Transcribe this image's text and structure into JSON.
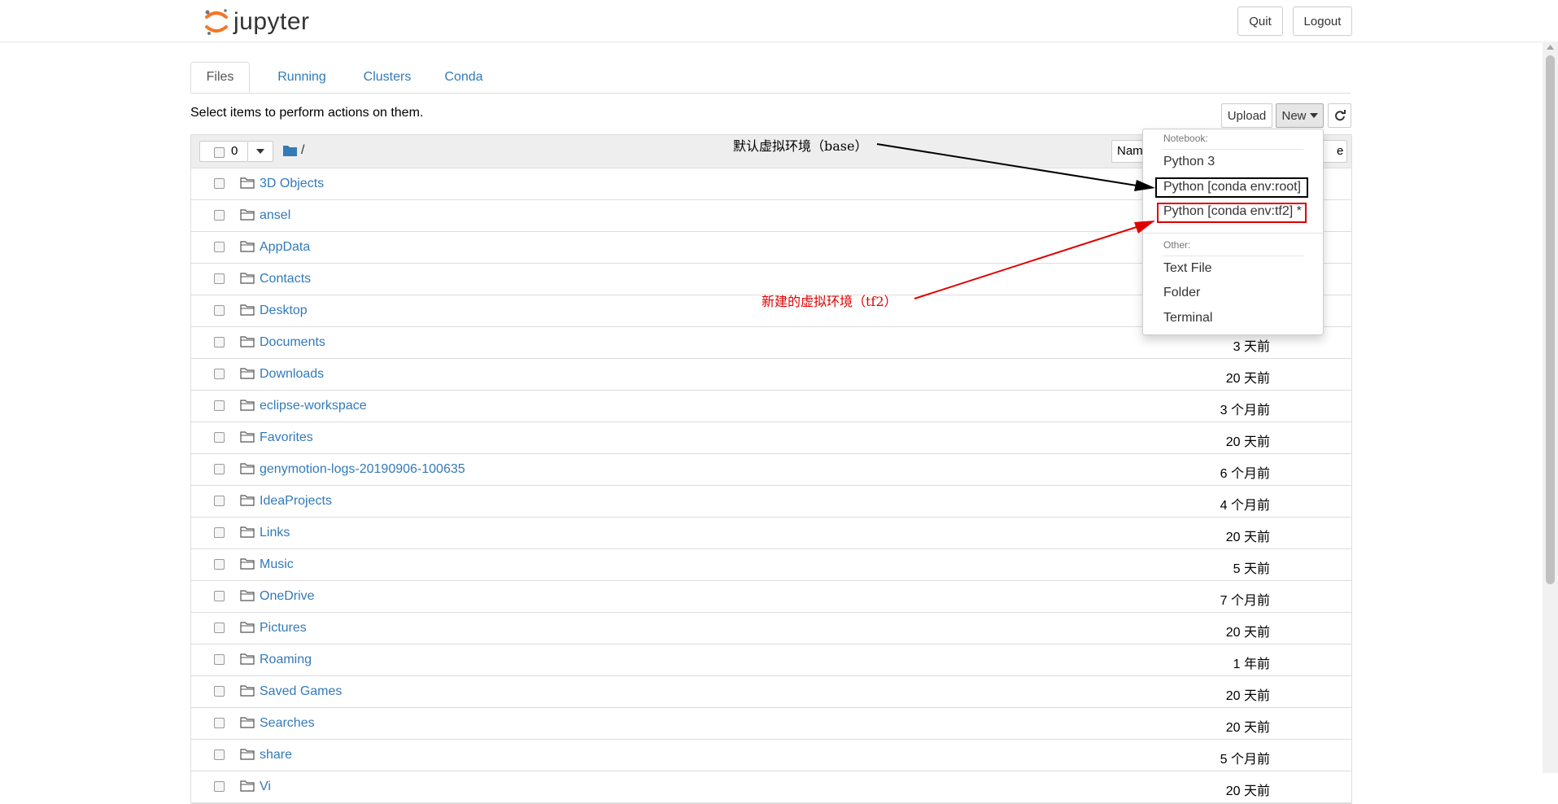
{
  "header": {
    "logo_text": "jupyter",
    "quit_label": "Quit",
    "logout_label": "Logout"
  },
  "tabs": [
    {
      "label": "Files",
      "active": true
    },
    {
      "label": "Running",
      "active": false
    },
    {
      "label": "Clusters",
      "active": false
    },
    {
      "label": "Conda",
      "active": false
    }
  ],
  "toolbar": {
    "hint": "Select items to perform actions on them.",
    "upload_label": "Upload",
    "new_label": "New",
    "refresh_icon": "refresh-icon",
    "selected_count": "0",
    "breadcrumb_path": "/",
    "name_sort_label": "Nam",
    "last_modified_label": "e"
  },
  "files": [
    {
      "name": "3D Objects",
      "modified": ""
    },
    {
      "name": "ansel",
      "modified": ""
    },
    {
      "name": "AppData",
      "modified": ""
    },
    {
      "name": "Contacts",
      "modified": ""
    },
    {
      "name": "Desktop",
      "modified": ""
    },
    {
      "name": "Documents",
      "modified": "3 天前"
    },
    {
      "name": "Downloads",
      "modified": "20 天前"
    },
    {
      "name": "eclipse-workspace",
      "modified": "3 个月前"
    },
    {
      "name": "Favorites",
      "modified": "20 天前"
    },
    {
      "name": "genymotion-logs-20190906-100635",
      "modified": "6 个月前"
    },
    {
      "name": "IdeaProjects",
      "modified": "4 个月前"
    },
    {
      "name": "Links",
      "modified": "20 天前"
    },
    {
      "name": "Music",
      "modified": "5 天前"
    },
    {
      "name": "OneDrive",
      "modified": "7 个月前"
    },
    {
      "name": "Pictures",
      "modified": "20 天前"
    },
    {
      "name": "Roaming",
      "modified": "1 年前"
    },
    {
      "name": "Saved Games",
      "modified": "20 天前"
    },
    {
      "name": "Searches",
      "modified": "20 天前"
    },
    {
      "name": "share",
      "modified": "5 个月前"
    },
    {
      "name": "Vi",
      "modified": "20 天前"
    }
  ],
  "new_menu": {
    "notebook_header": "Notebook:",
    "notebook_items": [
      "Python 3",
      "Python [conda env:root]",
      "Python [conda env:tf2] *"
    ],
    "other_header": "Other:",
    "other_items": [
      "Text File",
      "Folder",
      "Terminal"
    ]
  },
  "annotations": {
    "base_label": "默认虚拟环境（base）",
    "tf2_label": "新建的虚拟环境（tf2）",
    "base_color": "#000000",
    "tf2_color": "#e00000"
  },
  "colors": {
    "link": "#337ab7",
    "logo_orange": "#f37726"
  }
}
